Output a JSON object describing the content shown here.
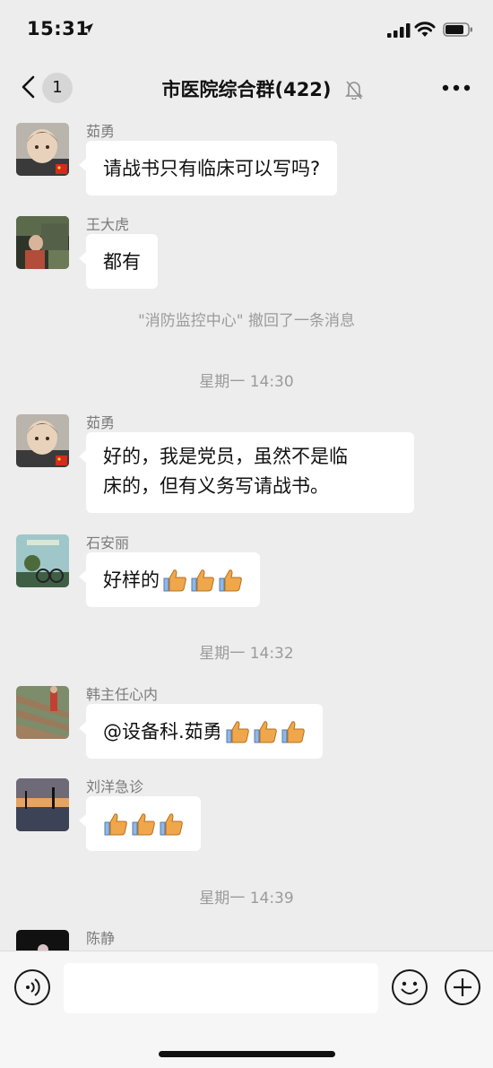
{
  "status_bar": {
    "time": "15:31"
  },
  "nav": {
    "unread_count": "1",
    "title": "市医院综合群(422)"
  },
  "messages": [
    {
      "sender": "茹勇",
      "text": "请战书只有临床可以写吗?"
    },
    {
      "sender": "王大虎",
      "text": "都有"
    },
    {
      "system": "\"消防监控中心\" 撤回了一条消息"
    },
    {
      "timestamp": "星期一 14:30"
    },
    {
      "sender": "茹勇",
      "text_line1": "好的，我是党员，虽然不是临",
      "text_line2": "床的，但有义务写请战书。"
    },
    {
      "sender": "石安丽",
      "text": "好样的"
    },
    {
      "timestamp": "星期一 14:32"
    },
    {
      "sender": "韩主任心内",
      "text": "@设备科.茹勇 "
    },
    {
      "sender": "刘洋急诊"
    },
    {
      "timestamp": "星期一 14:39"
    },
    {
      "sender": "陈静"
    }
  ],
  "colors": {
    "background": "#ededed",
    "bubble": "#ffffff",
    "thumb": "#f0a64a"
  }
}
